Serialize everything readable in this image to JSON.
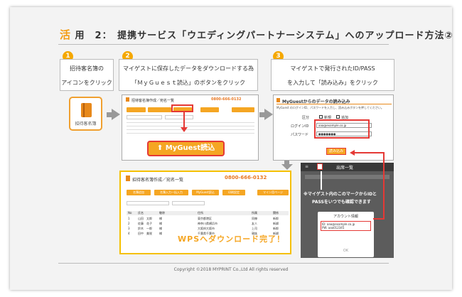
{
  "title": {
    "kanji": "活",
    "rest": "用　2：　提携サービス「ウエディングパートナーシステム」へのアップロード方法②"
  },
  "steps": [
    {
      "num": "1",
      "line1": "招待客名簿の",
      "line2": "アイコンをクリック"
    },
    {
      "num": "2",
      "line1": "マイゲストに保存したデータをダウンロードする為",
      "line2": "「ＭｙＧｕｅｓｔ読込」のボタンをクリック"
    },
    {
      "num": "3",
      "line1": "マイゲストで発行されたID/PASS",
      "line2": "を入力して「読み込み」をクリック"
    }
  ],
  "icon_card": {
    "label": "招待客名簿"
  },
  "shot2": {
    "title": "招待客名簿作成／宛名一覧",
    "phone": "0800-666-0132",
    "highlight_btn": "MyGuest読込"
  },
  "big_button": {
    "label": "MyGuest読込"
  },
  "shot3": {
    "title": "MyGuestからのデータの読み込み",
    "desc": "MyGuest のログインID、パスワードを入力し、読み込みボタンを押してください。",
    "opt_label": "区分",
    "opt_new": "新規",
    "opt_add": "追加",
    "login_label": "ログインID",
    "login_value": "aaa@example.co.jp",
    "pass_label": "パスワード",
    "pass_value": "●●●●●●●",
    "read_btn": "読み込み"
  },
  "shot4": {
    "title": "招待客名簿作成／宛名一覧",
    "phone": "0800-666-0132",
    "buttons": [
      "名簿追加",
      "名簿入力一括入力",
      "MyGuest読込",
      "印刷設定",
      "マイン用ページ"
    ],
    "headers": [
      "No",
      "氏名",
      "敬称",
      "住所",
      "所属",
      "関係"
    ],
    "rows": [
      [
        "1",
        "山田　太郎",
        "様",
        "東京都港区",
        "同僚",
        "新郎"
      ],
      [
        "2",
        "佐藤　花子",
        "様",
        "神奈川県横浜市",
        "友人",
        "新婦"
      ],
      [
        "3",
        "鈴木　一郎",
        "様",
        "大阪府大阪市",
        "上司",
        "新郎"
      ],
      [
        "4",
        "田中　美咲",
        "様",
        "千葉県千葉市",
        "親族",
        "新婦"
      ]
    ]
  },
  "wps_done": "WPSへダウンロード完了！",
  "phone": {
    "header": "出席一覧",
    "note1": "※マイゲスト内のこのマークからIDと",
    "note2": "PASSをいつでも確認できます",
    "popup_title": "アカウント情報",
    "popup_id": "ID: aaa@example.co.jp",
    "popup_pw": "PW: aaa012345",
    "popup_ok": "OK"
  },
  "footer": "Copyright ©2018 MYPRINT Co.,Ltd All rights reserved",
  "colors": {
    "accent": "#f5a623",
    "badge": "#f5a800",
    "red": "#e53935"
  }
}
